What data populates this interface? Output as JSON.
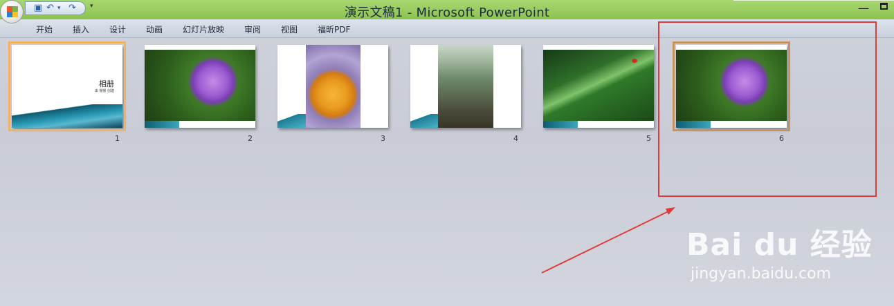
{
  "window": {
    "title": "演示文稿1 - Microsoft PowerPoint",
    "minimize_glyph": "—",
    "more_glyph": "▾"
  },
  "ribbon": {
    "tabs": [
      "开始",
      "插入",
      "设计",
      "动画",
      "幻灯片放映",
      "审阅",
      "视图",
      "福昕PDF"
    ]
  },
  "quick_access": [
    {
      "icon": "save-icon",
      "glyph": "▣"
    },
    {
      "icon": "undo-icon",
      "glyph": "↶"
    },
    {
      "icon": "dropdown-icon",
      "glyph": "▾"
    },
    {
      "icon": "redo-icon",
      "glyph": "↷"
    }
  ],
  "slides": [
    {
      "number": "1",
      "title": "相册",
      "subtitle": "由 猴猴 创建",
      "selected": true
    },
    {
      "number": "2",
      "image": "purple-hydrangea"
    },
    {
      "number": "3",
      "image": "yellow-rose"
    },
    {
      "number": "4",
      "image": "teapot-on-rocks"
    },
    {
      "number": "5",
      "image": "leaf-with-droplets-ladybug"
    },
    {
      "number": "6",
      "image": "purple-hydrangea",
      "highlighted": true
    }
  ],
  "annotation": {
    "color": "#e23a3a"
  },
  "watermark": {
    "logo": "Bai du 经验",
    "url": "jingyan.baidu.com"
  }
}
